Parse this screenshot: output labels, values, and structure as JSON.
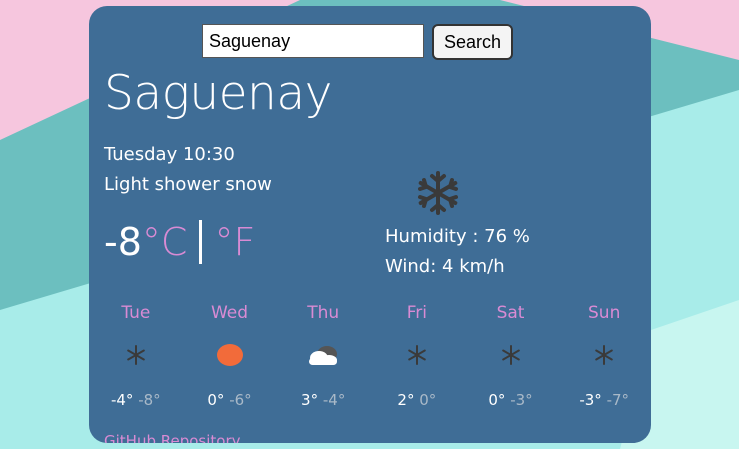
{
  "search": {
    "value": "Saguenay",
    "button_label": "Search"
  },
  "current": {
    "city": "Saguenay",
    "datetime": "Tuesday 10:30",
    "condition": "Light shower snow",
    "temperature": "-8",
    "unit_c": "°C",
    "unit_f": "°F",
    "humidity": "Humidity : 76 %",
    "wind": "Wind: 4 km/h",
    "icon": "snowflake-icon"
  },
  "forecast": [
    {
      "day": "Tue",
      "max": "-4°",
      "min": "-8°",
      "icon": "snowflake-icon"
    },
    {
      "day": "Wed",
      "max": "0°",
      "min": "-6°",
      "icon": "sun-icon"
    },
    {
      "day": "Thu",
      "max": "3°",
      "min": "-4°",
      "icon": "cloud-icon"
    },
    {
      "day": "Fri",
      "max": "2°",
      "min": "0°",
      "icon": "snowflake-icon"
    },
    {
      "day": "Sat",
      "max": "0°",
      "min": "-3°",
      "icon": "snowflake-icon"
    },
    {
      "day": "Sun",
      "max": "-3°",
      "min": "-7°",
      "icon": "snowflake-icon"
    }
  ],
  "footer": {
    "github_link": "GitHub Repository"
  },
  "colors": {
    "card": "#3f6d96",
    "accent": "#d98bd4",
    "sun": "#f26b3a"
  }
}
